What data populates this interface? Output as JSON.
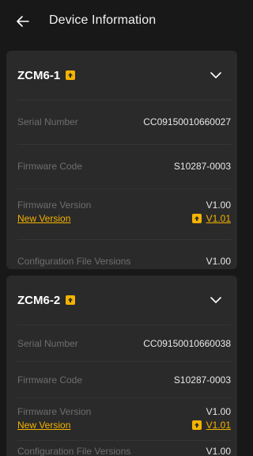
{
  "header": {
    "title": "Device Information",
    "back_icon": "arrow-left-icon"
  },
  "colors": {
    "background": "#181818",
    "card": "#2a2a2a",
    "accent": "#f5b300"
  },
  "devices": [
    {
      "name": "ZCM6-1",
      "serial_label": "Serial Number",
      "serial_value": "CC09150010660027",
      "fw_code_label": "Firmware Code",
      "fw_code_value": "S10287-0003",
      "fw_version_label": "Firmware Version",
      "fw_version_value": "V1.00",
      "new_version_label": "New Version",
      "new_version_value": "V1.01",
      "config_label": "Configuration File Versions",
      "config_value": "V1.00"
    },
    {
      "name": "ZCM6-2",
      "serial_label": "Serial Number",
      "serial_value": "CC09150010660038",
      "fw_code_label": "Firmware Code",
      "fw_code_value": "S10287-0003",
      "fw_version_label": "Firmware Version",
      "fw_version_value": "V1.00",
      "new_version_label": "New Version",
      "new_version_value": "V1.01",
      "config_label": "Configuration File Versions",
      "config_value": "V1.00"
    }
  ]
}
